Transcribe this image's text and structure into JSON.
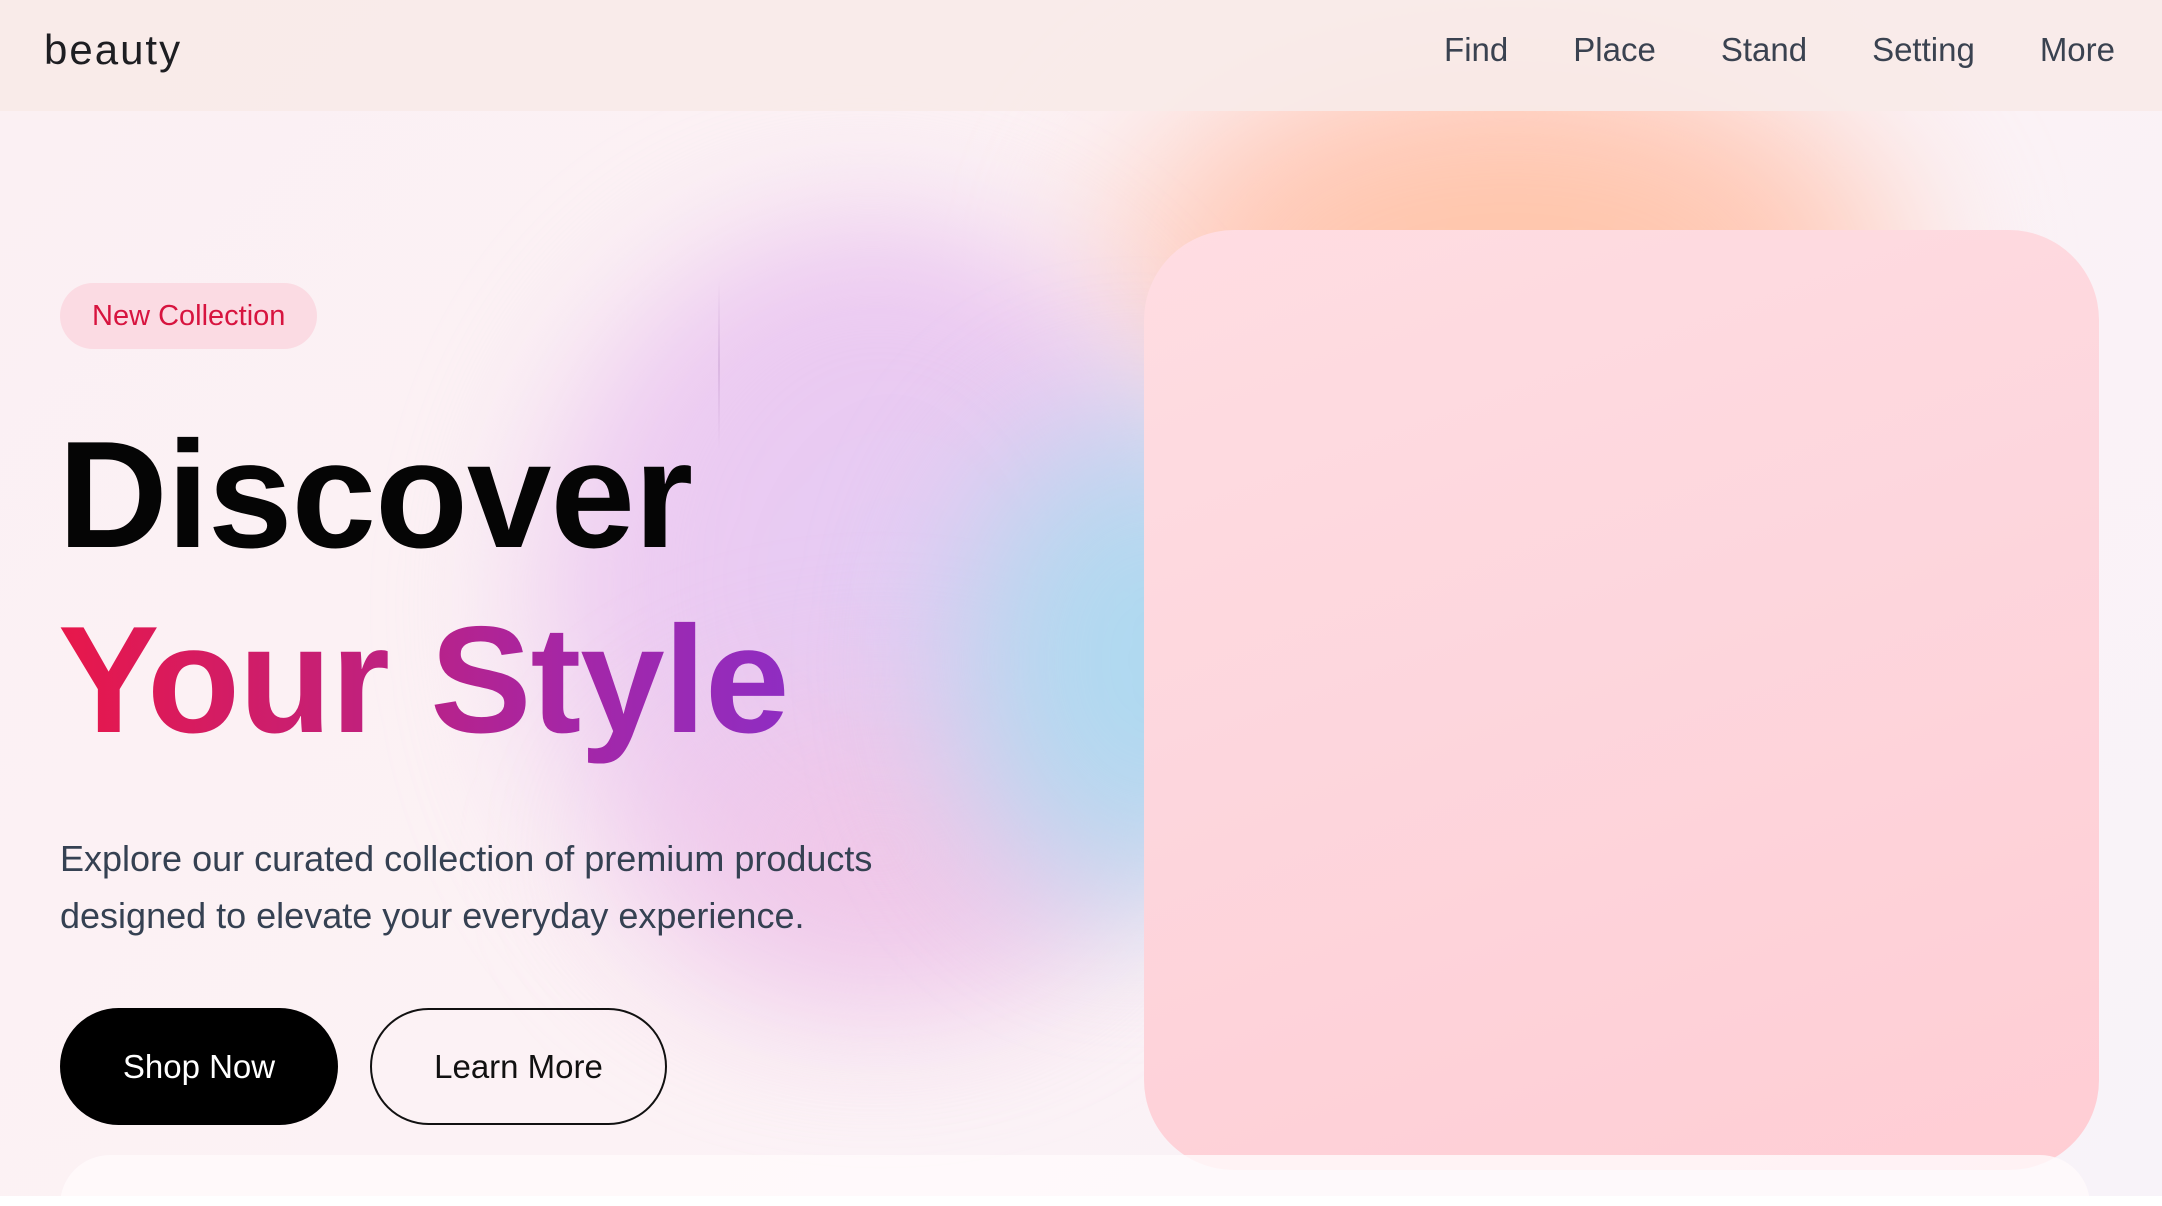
{
  "header": {
    "logo": "beauty",
    "nav": [
      {
        "label": "Find"
      },
      {
        "label": "Place"
      },
      {
        "label": "Stand"
      },
      {
        "label": "Setting"
      },
      {
        "label": "More"
      }
    ]
  },
  "hero": {
    "badge": "New Collection",
    "headline_line1": "Discover",
    "headline_line2": "Your Style",
    "subtitle_line1": "Explore our curated collection of premium products",
    "subtitle_line2": "designed to elevate your everyday experience.",
    "primary_button": "Shop Now",
    "secondary_button": "Learn More"
  },
  "colors": {
    "accent_red": "#e8174a",
    "accent_purple": "#8f2dc2",
    "badge_bg": "#fbdbe3",
    "card_pink": "#fdd6dd"
  }
}
